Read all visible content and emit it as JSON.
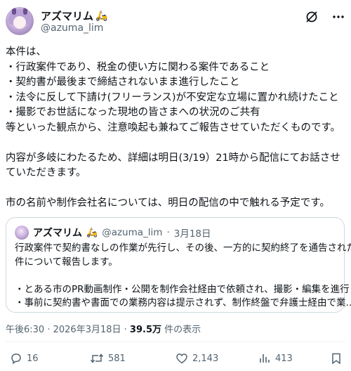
{
  "author": {
    "display_name": "アズマリム",
    "name_emoji": "🛵",
    "handle": "@azuma_lim"
  },
  "icons": {
    "grok": "grok-icon",
    "more": "more-icon",
    "reply": "reply-icon",
    "repost": "repost-icon",
    "like": "like-icon",
    "views": "views-icon",
    "bookmark": "bookmark-icon"
  },
  "post": {
    "lines": [
      "本件は、",
      "・行政案件であり、税金の使い方に関わる案件であること",
      "・契約書が最後まで締結されないまま進行したこと",
      "・法令に反して下請け(フリーランス)が不安定な立場に置かれ続けたこと",
      "・撮影でお世話になった現地の皆さまへの状況のご共有",
      "等といった観点から、注意喚起も兼ねてご報告させていただくものです。",
      "",
      "内容が多岐にわたるため、詳細は明日(3/19）21時から配信にてお話させ",
      "ていただきます。",
      "",
      "市の名前や制作会社名については、明日の配信の中で触れる予定です。"
    ]
  },
  "quote": {
    "display_name": "アズマリム",
    "name_emoji": "🛵",
    "handle": "@azuma_lim",
    "date": "3月18日",
    "lines": [
      "行政案件で契約書なしの作業が先行し、その後、一方的に契約終了を通告された",
      "件について報告します。",
      "",
      "・とある市のPR動画制作・公開を制作会社経由で依頼され、撮影・編集を進行",
      "・事前に契約書や書面での業務内容は提示されず、制作終盤で弁護士経由で業..."
    ]
  },
  "meta": {
    "time": "午後6:30",
    "date": "2026年3月18日",
    "views": "39.5万",
    "views_label": "件の表示"
  },
  "stats": {
    "replies": "16",
    "reposts": "581",
    "likes": "2,143",
    "views": "413"
  }
}
